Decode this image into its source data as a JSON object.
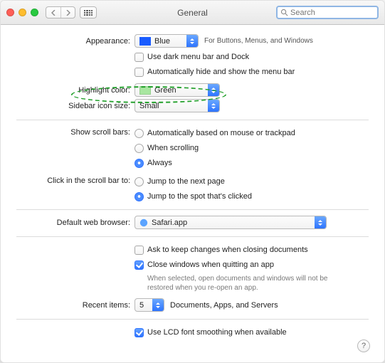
{
  "window": {
    "title": "General"
  },
  "search": {
    "placeholder": "Search"
  },
  "labels": {
    "appearance": "Appearance:",
    "highlight": "Highlight color:",
    "sidebar": "Sidebar icon size:",
    "scrollbars": "Show scroll bars:",
    "clickbar": "Click in the scroll bar to:",
    "browser": "Default web browser:",
    "recent": "Recent items:"
  },
  "appearance": {
    "value": "Blue",
    "hint": "For Buttons, Menus, and Windows",
    "dark_menu": "Use dark menu bar and Dock",
    "auto_hide": "Automatically hide and show the menu bar"
  },
  "highlight": {
    "value": "Green"
  },
  "sidebar": {
    "value": "Small"
  },
  "scrollbars": {
    "opt_auto": "Automatically based on mouse or trackpad",
    "opt_scrolling": "When scrolling",
    "opt_always": "Always"
  },
  "clickbar": {
    "opt_next": "Jump to the next page",
    "opt_spot": "Jump to the spot that's clicked"
  },
  "browser": {
    "value": "Safari.app"
  },
  "documents": {
    "ask": "Ask to keep changes when closing documents",
    "close": "Close windows when quitting an app",
    "close_hint": "When selected, open documents and windows will not be restored when you re-open an app."
  },
  "recent": {
    "value": "5",
    "suffix": "Documents, Apps, and Servers"
  },
  "lcd": {
    "label": "Use LCD font smoothing when available"
  },
  "help": {
    "glyph": "?"
  }
}
